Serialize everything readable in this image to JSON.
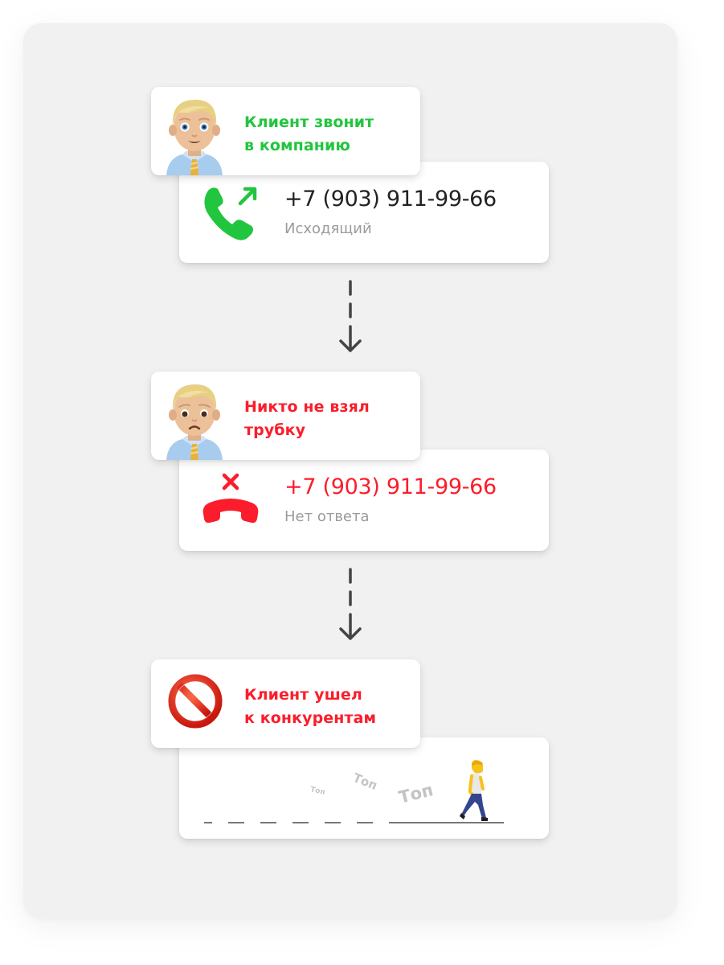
{
  "colors": {
    "success": "#22c53e",
    "danger": "#fb1d2b",
    "text_primary": "#222222",
    "text_secondary": "#9b9b9b",
    "panel_bg": "#f1f1f1",
    "arrow": "#444444"
  },
  "steps": [
    {
      "label": {
        "icon": "man-office-worker-smiling-emoji",
        "line1": "Клиент звонит",
        "line2": "в компанию",
        "tone": "success"
      },
      "detail": {
        "icon": "outgoing-call-icon",
        "phone": "+7 (903) 911-99-66",
        "status": "Исходящий"
      }
    },
    {
      "label": {
        "icon": "man-office-worker-sad-emoji",
        "line1": "Никто не взял",
        "line2": "трубку",
        "tone": "danger"
      },
      "detail": {
        "icon": "missed-call-icon",
        "phone": "+7 (903) 911-99-66",
        "status": "Нет ответа"
      }
    },
    {
      "label": {
        "icon": "prohibited-emoji",
        "line1": "Клиент ушел",
        "line2": "к конкурентам",
        "tone": "danger"
      },
      "detail": {
        "icon": "walking-person-emoji",
        "footsteps": [
          "Топ",
          "Топ",
          "Топ"
        ]
      }
    }
  ],
  "connectors": [
    {
      "icon": "dashed-arrow-down-icon"
    },
    {
      "icon": "dashed-arrow-down-icon"
    }
  ]
}
